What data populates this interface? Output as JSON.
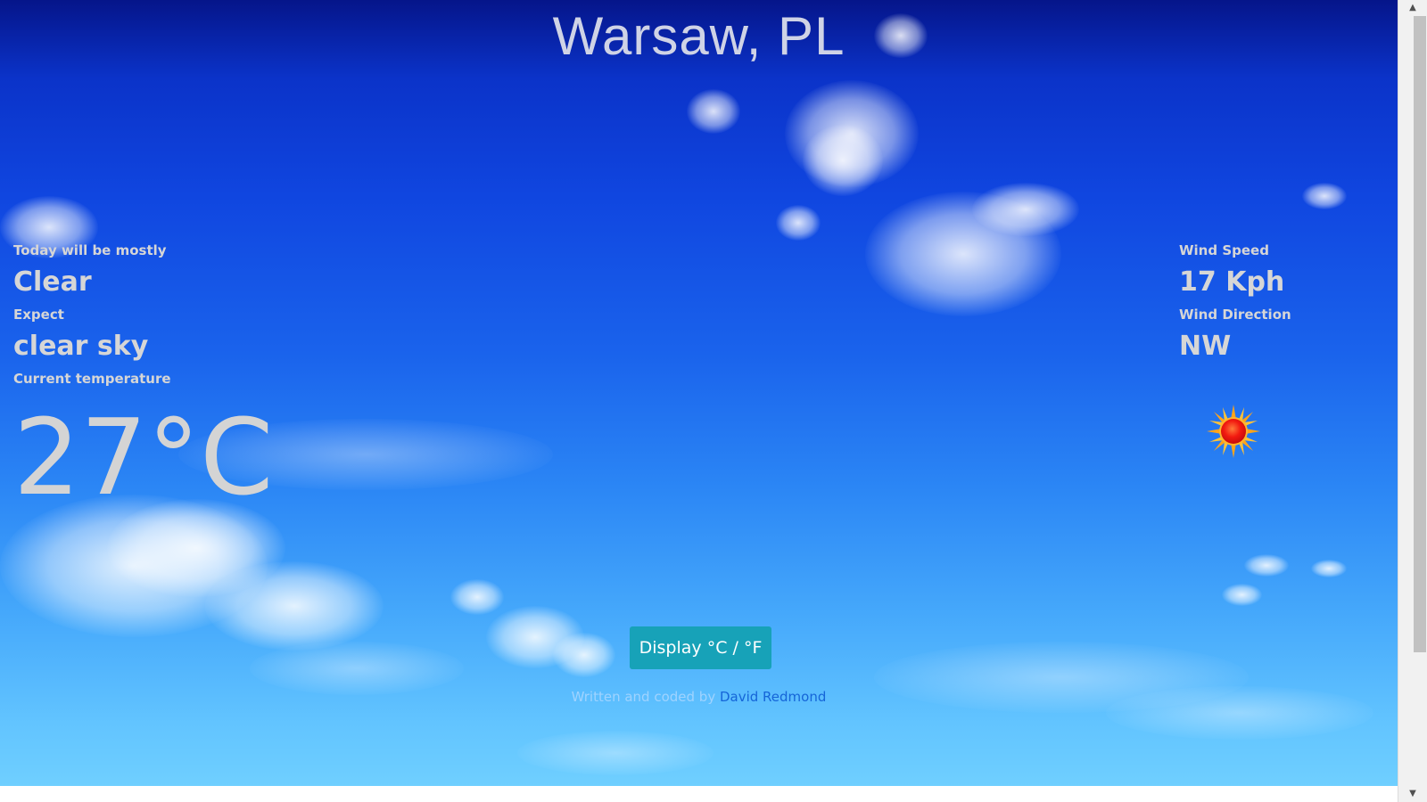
{
  "location": {
    "city": "Warsaw, PL"
  },
  "conditions": {
    "summary_label": "Today will be mostly",
    "summary_value": "Clear",
    "expect_label": "Expect",
    "expect_value": "clear sky",
    "temp_label": "Current temperature",
    "temp_value": "27°C"
  },
  "wind": {
    "speed_label": "Wind Speed",
    "speed_value": "17 Kph",
    "direction_label": "Wind Direction",
    "direction_value": "NW"
  },
  "weather_icon": "sun-icon",
  "toggle": {
    "label": "Display °C / °F"
  },
  "footer": {
    "credit_text": "Written and coded by",
    "author_link": "David Redmond"
  },
  "colors": {
    "button": "#17a2b8",
    "link": "#1565d8",
    "text": "#d6d6d6"
  }
}
